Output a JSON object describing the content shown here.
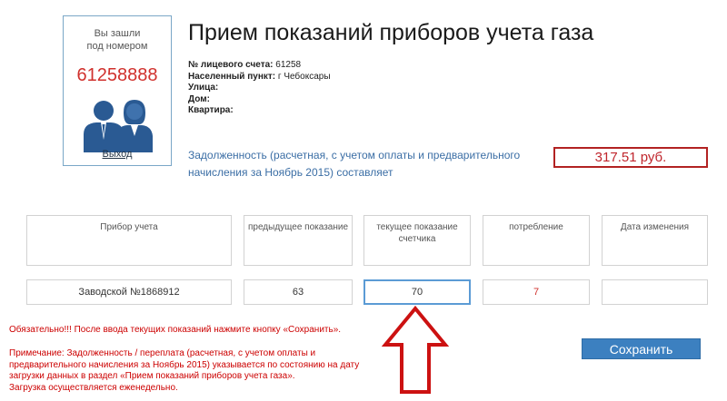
{
  "login": {
    "caption_line1": "Вы зашли",
    "caption_line2": "под номером",
    "number": "61258888",
    "logout": "Выход"
  },
  "page_title": "Прием показаний приборов учета газа",
  "info": {
    "account_label": "№ лицевого счета:",
    "account_value": "61258",
    "locality_label": "Населенный пункт:",
    "locality_value": "г Чебоксары",
    "street_label": "Улица:",
    "house_label": "Дом:",
    "apartment_label": "Квартира:"
  },
  "debt": {
    "text": "Задолженность (расчетная, с учетом оплаты и предварительного начисления за Ноябрь 2015) составляет",
    "amount": "317.51 руб."
  },
  "table": {
    "headers": {
      "device": "Прибор учета",
      "previous": "предыдущее показание",
      "current": "текущее показание счетчика",
      "consumption": "потребление",
      "date": "Дата изменения"
    },
    "row": {
      "device": "Заводской №1868912",
      "previous": "63",
      "current": "70",
      "consumption": "7",
      "date": ""
    }
  },
  "notice": "Обязательно!!! После ввода текущих показаний нажмите кнопку «Сохранить».",
  "note": {
    "line1": "Примечание: Задолженность / переплата (расчетная, с учетом оплаты и предварительного начисления за Ноябрь 2015) указывается по состоянию на дату загрузки данных в раздел «Прием показаний приборов учета газа».",
    "line2": "Загрузка осуществляется еженедельно."
  },
  "save_button": "Сохранить",
  "colors": {
    "accent_blue": "#3c80c0",
    "alert_red": "#cc0000",
    "arrow_red": "#cc1111"
  },
  "icons": {
    "avatar": "users-icon",
    "arrow": "arrow-up-icon"
  }
}
